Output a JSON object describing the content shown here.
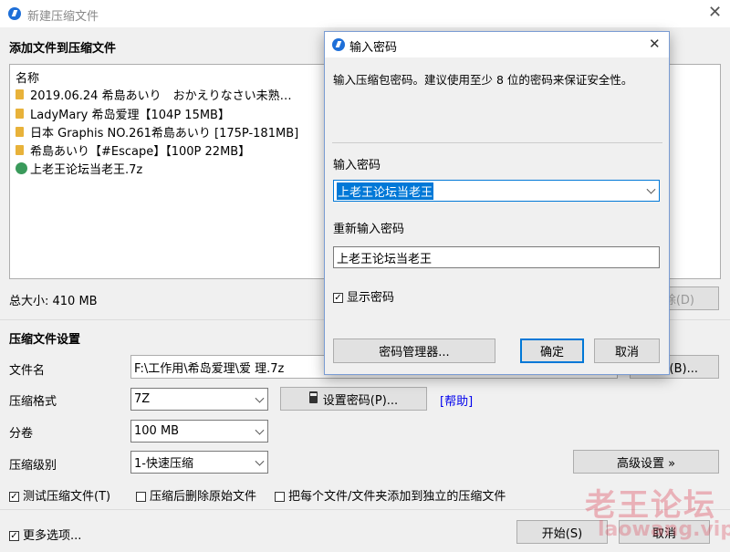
{
  "main_window": {
    "title": "新建压缩文件",
    "section_title": "添加文件到压缩文件",
    "list_header": "名称",
    "files": [
      {
        "name": "2019.06.24 希島あいり　おかえりなさい未熟…",
        "icon": "folder-icon"
      },
      {
        "name": "LadyMary 希岛爱理【104P 15MB】",
        "icon": "folder-icon"
      },
      {
        "name": "日本 Graphis NO.261希島あいり [175P-181MB]",
        "icon": "folder-icon"
      },
      {
        "name": "希島あいり【#Escape】【100P 22MB】",
        "icon": "folder-icon"
      },
      {
        "name": "上老王论坛当老王.7z",
        "icon": "archive-icon"
      }
    ],
    "total_size": "总大小: 410 MB",
    "delete_button": "除(D)",
    "settings_title": "压缩文件设置",
    "filename_label": "文件名",
    "filename_value": "F:\\工作用\\希岛爱理\\爱 理.7z",
    "browse_button": "览(B)...",
    "format_label": "压缩格式",
    "format_value": "7Z",
    "set_password_button": "设置密码(P)...",
    "help_link": "[帮助]",
    "volume_label": "分卷",
    "volume_value": "100 MB",
    "level_label": "压缩级别",
    "level_value": "1-快速压缩",
    "advanced_button": "高级设置 »",
    "test_checkbox": "测试压缩文件(T)",
    "delete_after_checkbox": "压缩后删除原始文件",
    "separate_checkbox": "把每个文件/文件夹添加到独立的压缩文件",
    "more_options": "更多选项...",
    "start_button": "开始(S)",
    "cancel_button": "取消"
  },
  "password_dialog": {
    "title": "输入密码",
    "message": "输入压缩包密码。建议使用至少 8 位的密码来保证安全性。",
    "password_label": "输入密码",
    "password_value": "上老王论坛当老王",
    "reenter_label": "重新输入密码",
    "reenter_value": "上老王论坛当老王",
    "show_password": "显示密码",
    "manager_button": "密码管理器...",
    "ok_button": "确定",
    "cancel_button": "取消"
  },
  "watermark": {
    "text": "老王论坛",
    "url": "laowang.vip"
  },
  "colors": {
    "accent": "#0078d7",
    "selection": "#0078d7",
    "link": "#0000ee",
    "folder": "#e8b23a"
  }
}
